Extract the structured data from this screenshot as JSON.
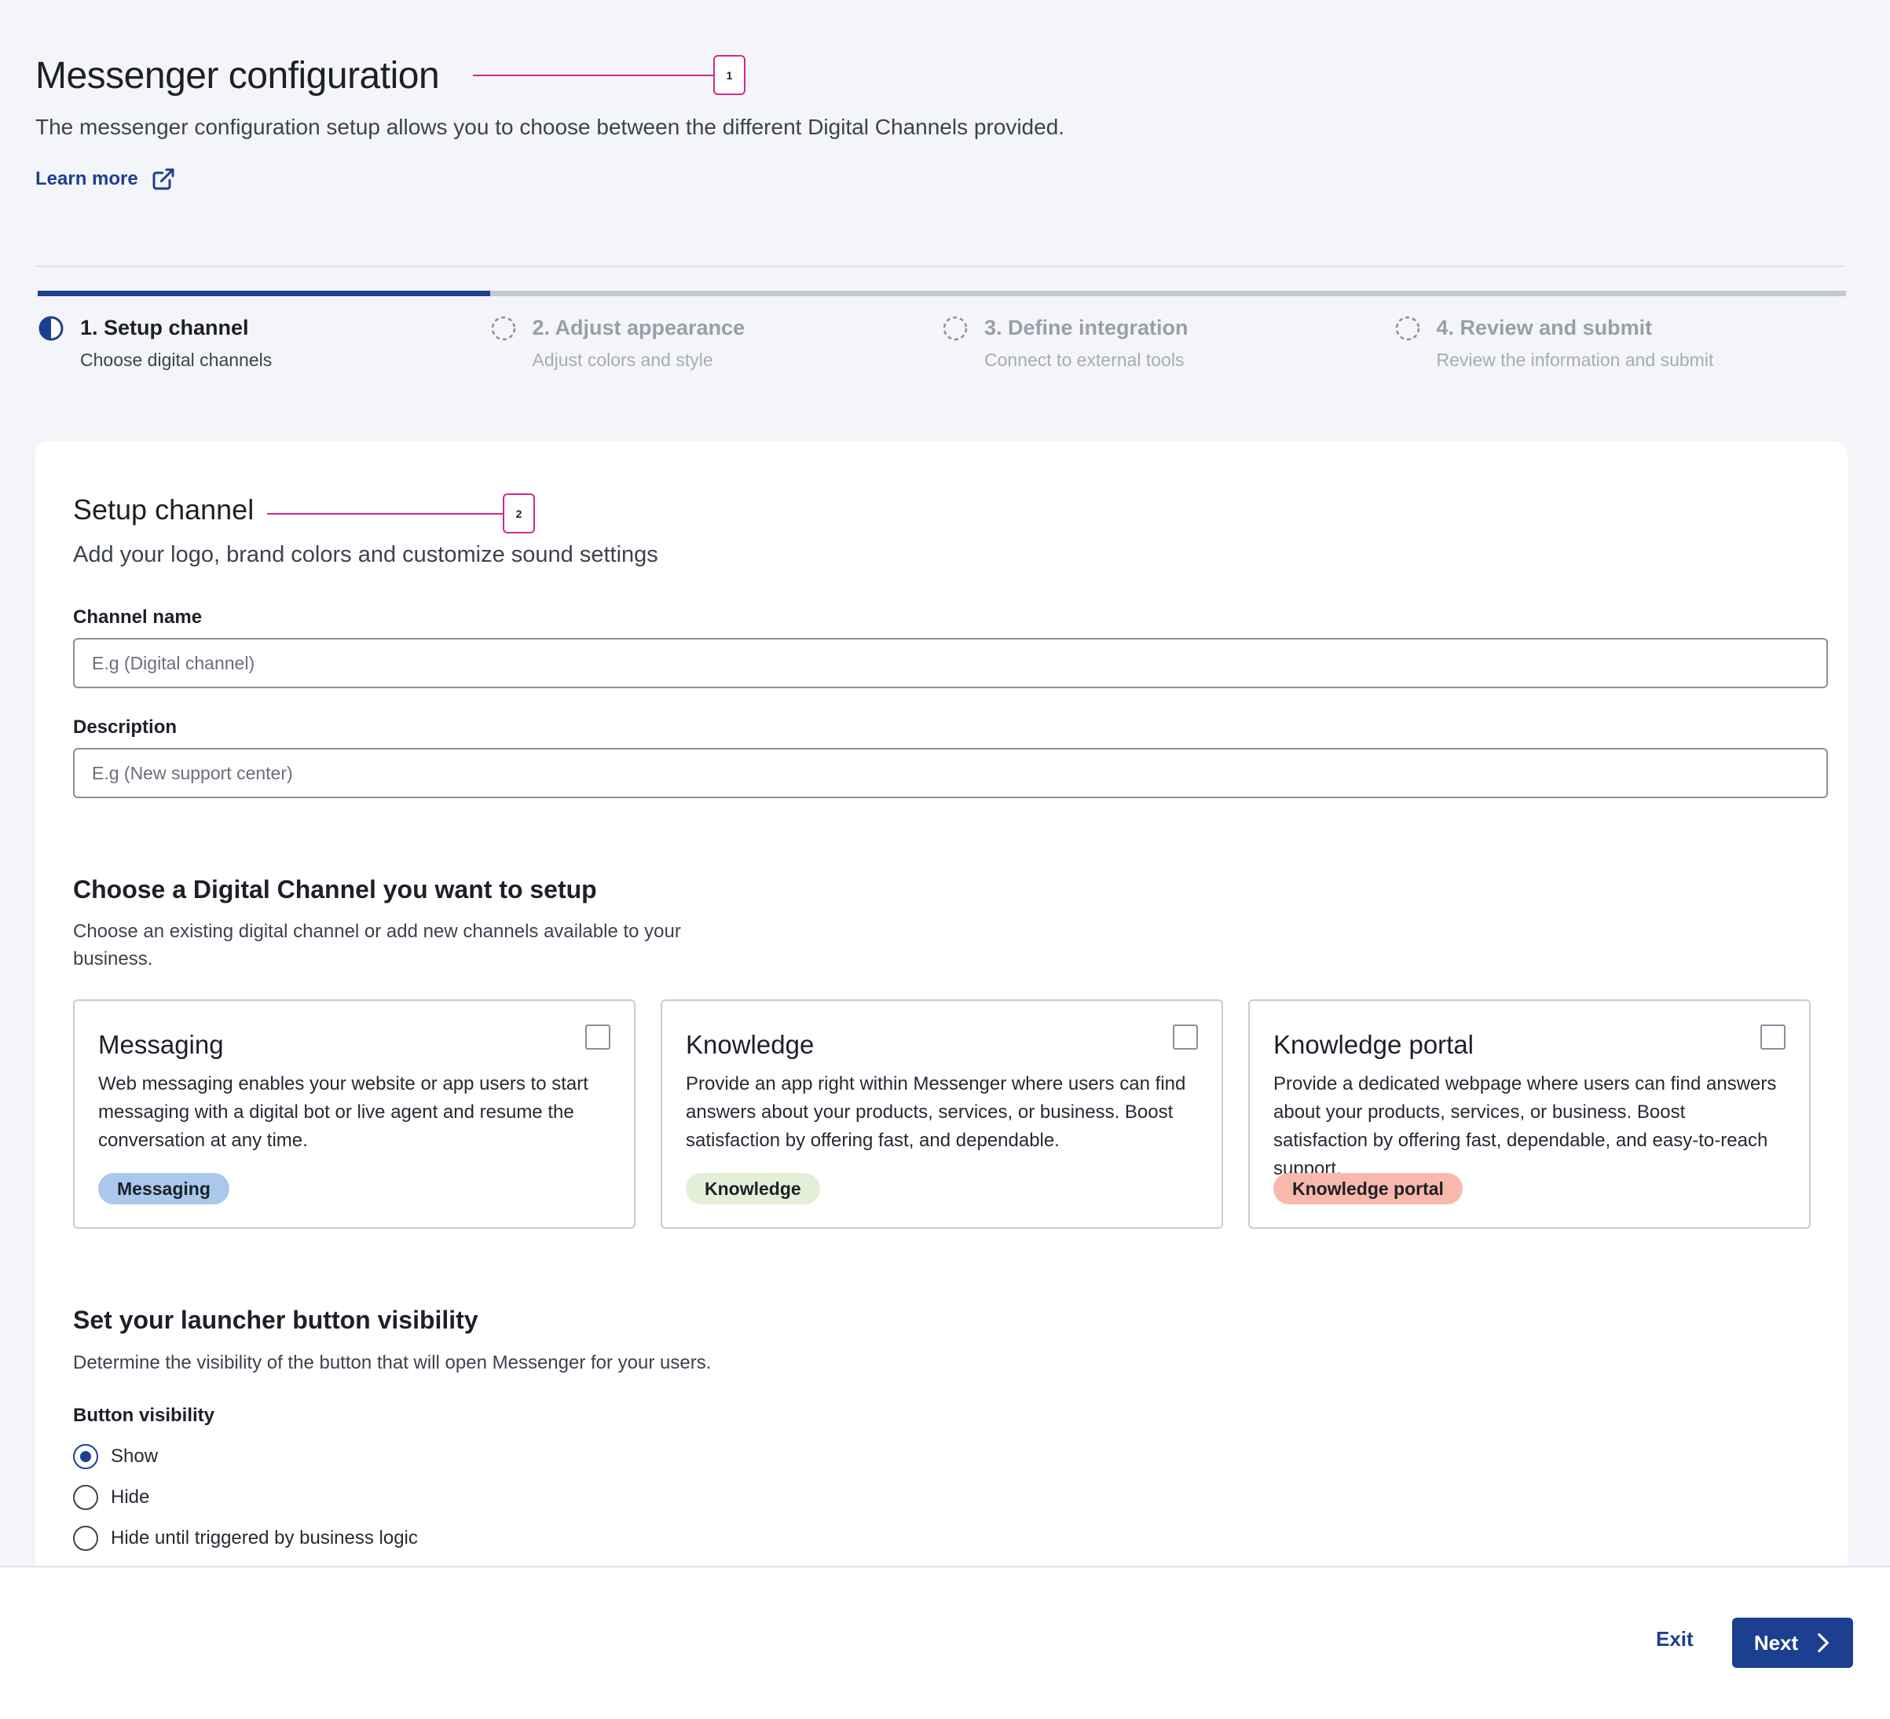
{
  "header": {
    "title": "Messenger configuration",
    "description": "The messenger configuration setup allows you to choose between the different Digital Channels provided.",
    "learn_more": "Learn more",
    "callout": "1"
  },
  "stepper": {
    "steps": [
      {
        "title": "1. Setup channel",
        "subtitle": "Choose digital channels",
        "state": "active"
      },
      {
        "title": "2. Adjust appearance",
        "subtitle": "Adjust colors and style",
        "state": "pending"
      },
      {
        "title": "3. Define integration",
        "subtitle": "Connect to external tools",
        "state": "pending"
      },
      {
        "title": "4. Review and submit",
        "subtitle": "Review the information and submit",
        "state": "pending"
      }
    ]
  },
  "setup": {
    "title": "Setup channel",
    "callout": "2",
    "subtitle": "Add your logo, brand colors and customize sound settings",
    "channel_name_label": "Channel name",
    "channel_name_placeholder": "E.g (Digital channel)",
    "description_label": "Description",
    "description_placeholder": "E.g (New support center)"
  },
  "channels": {
    "title": "Choose a Digital Channel you want to setup",
    "description": "Choose an existing digital channel or add new channels available to your business.",
    "tiles": [
      {
        "title": "Messaging",
        "description": "Web messaging enables your website or app users to start messaging with a digital bot or live agent and resume the conversation at any time.",
        "tag": "Messaging",
        "tag_color": "#a9c8ec",
        "checked": false
      },
      {
        "title": "Knowledge",
        "description": "Provide an app right within Messenger where users can find answers about your products, services, or business. Boost satisfaction by offering fast, and dependable.",
        "tag": "Knowledge",
        "tag_color": "#e3efd6",
        "checked": false
      },
      {
        "title": "Knowledge portal",
        "description": "Provide a dedicated webpage where users can find answers about your products, services, or business. Boost satisfaction by offering fast, dependable, and easy-to-reach support.",
        "tag": "Knowledge portal",
        "tag_color": "#f8b9ac",
        "checked": false
      }
    ]
  },
  "launcher": {
    "title": "Set your launcher button visibility",
    "description": "Determine the visibility of the button that will open Messenger for your users.",
    "field_label": "Button visibility",
    "options": [
      "Show",
      "Hide",
      "Hide until triggered by business logic"
    ],
    "selected": "Show"
  },
  "footer": {
    "exit_label": "Exit",
    "next_label": "Next"
  },
  "colors": {
    "accent": "#1d3f8f",
    "callout": "#d3288f",
    "background": "#f4f5f9"
  }
}
